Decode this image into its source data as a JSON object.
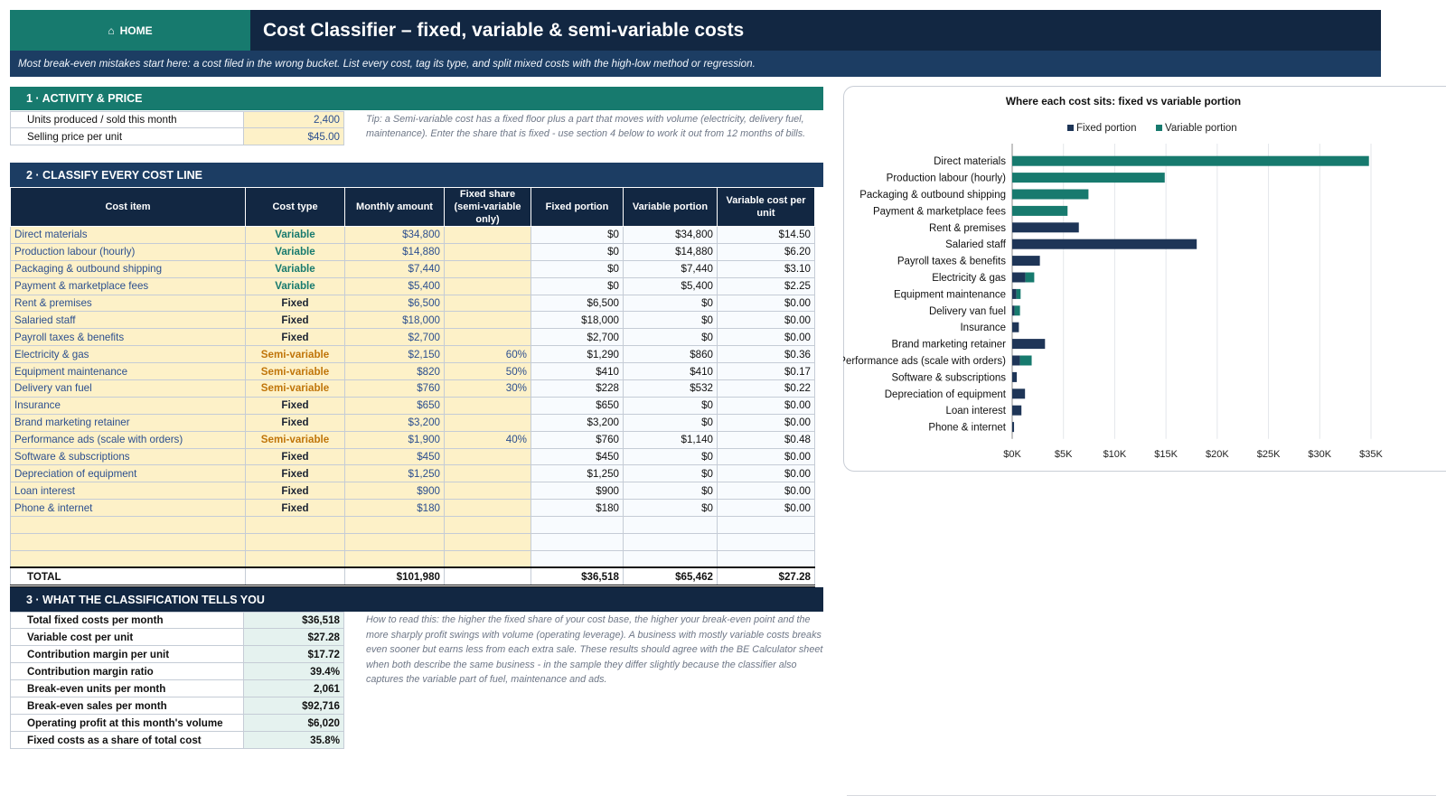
{
  "header": {
    "home_label": "HOME",
    "home_icon": "home-icon",
    "title": "Cost Classifier  –  fixed, variable & semi-variable costs",
    "subtitle": "Most break-even mistakes start here: a cost filed in the wrong bucket. List every cost, tag its type, and split mixed costs with the high-low method or regression."
  },
  "colors": {
    "teal": "#177a6e",
    "navy": "#122742",
    "blue": "#1c3d63",
    "input_fill": "#fdf1c8",
    "semi_variable_text": "#c0750a"
  },
  "section1": {
    "title": "1 · ACTIVITY & PRICE",
    "rows": [
      {
        "label": "Units produced / sold this month",
        "value": "2,400"
      },
      {
        "label": "Selling price per unit",
        "value": "$45.00"
      }
    ],
    "tip": "Tip: a Semi-variable cost has a fixed floor plus a part that moves with volume (electricity, delivery fuel, maintenance). Enter the share that is fixed - use section 4 below to work it out from 12 months of bills."
  },
  "section2": {
    "title": "2 · CLASSIFY EVERY COST LINE",
    "columns": [
      "Cost item",
      "Cost type",
      "Monthly amount",
      "Fixed share (semi-variable only)",
      "Fixed portion",
      "Variable portion",
      "Variable cost per unit"
    ],
    "rows": [
      {
        "item": "Direct materials",
        "type": "Variable",
        "amount": "$34,800",
        "share": "",
        "fixed": "$0",
        "variable": "$34,800",
        "per_unit": "$14.50"
      },
      {
        "item": "Production labour (hourly)",
        "type": "Variable",
        "amount": "$14,880",
        "share": "",
        "fixed": "$0",
        "variable": "$14,880",
        "per_unit": "$6.20"
      },
      {
        "item": "Packaging & outbound shipping",
        "type": "Variable",
        "amount": "$7,440",
        "share": "",
        "fixed": "$0",
        "variable": "$7,440",
        "per_unit": "$3.10"
      },
      {
        "item": "Payment & marketplace fees",
        "type": "Variable",
        "amount": "$5,400",
        "share": "",
        "fixed": "$0",
        "variable": "$5,400",
        "per_unit": "$2.25"
      },
      {
        "item": "Rent & premises",
        "type": "Fixed",
        "amount": "$6,500",
        "share": "",
        "fixed": "$6,500",
        "variable": "$0",
        "per_unit": "$0.00"
      },
      {
        "item": "Salaried staff",
        "type": "Fixed",
        "amount": "$18,000",
        "share": "",
        "fixed": "$18,000",
        "variable": "$0",
        "per_unit": "$0.00"
      },
      {
        "item": "Payroll taxes & benefits",
        "type": "Fixed",
        "amount": "$2,700",
        "share": "",
        "fixed": "$2,700",
        "variable": "$0",
        "per_unit": "$0.00"
      },
      {
        "item": "Electricity & gas",
        "type": "Semi-variable",
        "amount": "$2,150",
        "share": "60%",
        "fixed": "$1,290",
        "variable": "$860",
        "per_unit": "$0.36"
      },
      {
        "item": "Equipment maintenance",
        "type": "Semi-variable",
        "amount": "$820",
        "share": "50%",
        "fixed": "$410",
        "variable": "$410",
        "per_unit": "$0.17"
      },
      {
        "item": "Delivery van fuel",
        "type": "Semi-variable",
        "amount": "$760",
        "share": "30%",
        "fixed": "$228",
        "variable": "$532",
        "per_unit": "$0.22"
      },
      {
        "item": "Insurance",
        "type": "Fixed",
        "amount": "$650",
        "share": "",
        "fixed": "$650",
        "variable": "$0",
        "per_unit": "$0.00"
      },
      {
        "item": "Brand marketing retainer",
        "type": "Fixed",
        "amount": "$3,200",
        "share": "",
        "fixed": "$3,200",
        "variable": "$0",
        "per_unit": "$0.00"
      },
      {
        "item": "Performance ads (scale with orders)",
        "type": "Semi-variable",
        "amount": "$1,900",
        "share": "40%",
        "fixed": "$760",
        "variable": "$1,140",
        "per_unit": "$0.48"
      },
      {
        "item": "Software & subscriptions",
        "type": "Fixed",
        "amount": "$450",
        "share": "",
        "fixed": "$450",
        "variable": "$0",
        "per_unit": "$0.00"
      },
      {
        "item": "Depreciation of equipment",
        "type": "Fixed",
        "amount": "$1,250",
        "share": "",
        "fixed": "$1,250",
        "variable": "$0",
        "per_unit": "$0.00"
      },
      {
        "item": "Loan interest",
        "type": "Fixed",
        "amount": "$900",
        "share": "",
        "fixed": "$900",
        "variable": "$0",
        "per_unit": "$0.00"
      },
      {
        "item": "Phone & internet",
        "type": "Fixed",
        "amount": "$180",
        "share": "",
        "fixed": "$180",
        "variable": "$0",
        "per_unit": "$0.00"
      }
    ],
    "blank_rows": 3,
    "total": {
      "label": "TOTAL",
      "amount": "$101,980",
      "fixed": "$36,518",
      "variable": "$65,462",
      "per_unit": "$27.28"
    }
  },
  "section3": {
    "title": "3 · WHAT THE CLASSIFICATION TELLS YOU",
    "rows": [
      {
        "label": "Total fixed costs per month",
        "value": "$36,518"
      },
      {
        "label": "Variable cost per unit",
        "value": "$27.28"
      },
      {
        "label": "Contribution margin per unit",
        "value": "$17.72"
      },
      {
        "label": "Contribution margin ratio",
        "value": "39.4%"
      },
      {
        "label": "Break-even units per month",
        "value": "2,061"
      },
      {
        "label": "Break-even sales per month",
        "value": "$92,716"
      },
      {
        "label": "Operating profit at this month's volume",
        "value": "$6,020"
      },
      {
        "label": "Fixed costs as a share of total cost",
        "value": "35.8%"
      }
    ],
    "note": "How to read this: the higher the fixed share of your cost base, the higher your break-even point and the more sharply profit swings with volume (operating leverage). A business with mostly variable costs breaks even sooner but earns less from each extra sale. These results should agree with the BE Calculator sheet when both describe the same business - in the sample they differ slightly because the classifier also captures the variable part of fuel, maintenance and ads."
  },
  "chart_data": {
    "type": "bar",
    "orientation": "horizontal",
    "stacked": true,
    "title": "Where each cost sits: fixed vs variable portion",
    "categories": [
      "Direct materials",
      "Production labour (hourly)",
      "Packaging & outbound shipping",
      "Payment & marketplace fees",
      "Rent & premises",
      "Salaried staff",
      "Payroll taxes & benefits",
      "Electricity & gas",
      "Equipment maintenance",
      "Delivery van fuel",
      "Insurance",
      "Brand marketing retainer",
      "Performance ads (scale with orders)",
      "Software & subscriptions",
      "Depreciation of equipment",
      "Loan interest",
      "Phone & internet"
    ],
    "series": [
      {
        "name": "Fixed portion",
        "color": "#1e3557",
        "values": [
          0,
          0,
          0,
          0,
          6500,
          18000,
          2700,
          1290,
          410,
          228,
          650,
          3200,
          760,
          450,
          1250,
          900,
          180
        ]
      },
      {
        "name": "Variable portion",
        "color": "#177a6e",
        "values": [
          34800,
          14880,
          7440,
          5400,
          0,
          0,
          0,
          860,
          410,
          532,
          0,
          0,
          1140,
          0,
          0,
          0,
          0
        ]
      }
    ],
    "xlim": [
      0,
      35000
    ],
    "x_ticks": [
      0,
      5000,
      10000,
      15000,
      20000,
      25000,
      30000,
      35000
    ],
    "x_tick_labels": [
      "$0K",
      "$5K",
      "$10K",
      "$15K",
      "$20K",
      "$25K",
      "$30K",
      "$35K"
    ],
    "grid": true,
    "legend_position": "top"
  }
}
